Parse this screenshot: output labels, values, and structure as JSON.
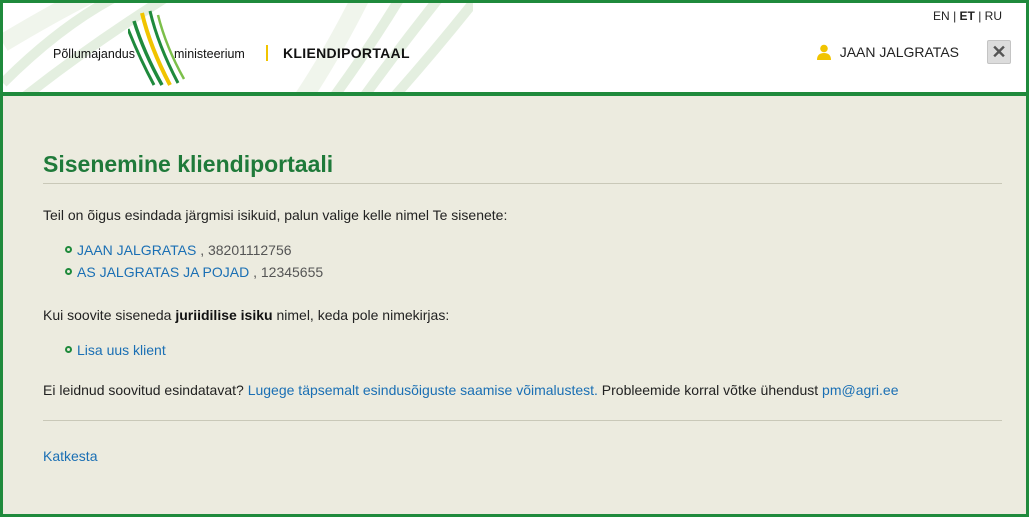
{
  "header": {
    "logo_left": "Põllumajandus",
    "logo_right": "ministeerium",
    "portal_name": "KLIENDIPORTAAL",
    "languages": [
      "EN",
      "ET",
      "RU"
    ],
    "active_language": "ET",
    "user_name": "JAAN JALGRATAS",
    "close_label": "✕"
  },
  "main": {
    "title": "Sisenemine kliendiportaali",
    "intro": "Teil on õigus esindada järgmisi isikuid, palun valige kelle nimel Te sisenete:",
    "clients": [
      {
        "name": "JAAN JALGRATAS",
        "code": ", 38201112756"
      },
      {
        "name": "AS JALGRATAS JA POJAD",
        "code": ", 12345655"
      }
    ],
    "juriid_before": "Kui soovite siseneda ",
    "juriid_bold": "juriidilise isiku",
    "juriid_after": " nimel, keda pole nimekirjas:",
    "add_client": "Lisa uus klient",
    "notfound_before": "Ei leidnud soovitud esindatavat? ",
    "notfound_link": "Lugege täpsemalt esindusõiguste saamise võimalustest.",
    "notfound_middle": " Probleemide korral võtke ühendust ",
    "contact_email": "pm@agri.ee",
    "cancel": "Katkesta"
  },
  "colors": {
    "brand_green": "#1f8a3c",
    "title_green": "#1f7a3a",
    "link_blue": "#1a6fb4",
    "accent_yellow": "#f1c400",
    "background": "#ecebdf"
  }
}
